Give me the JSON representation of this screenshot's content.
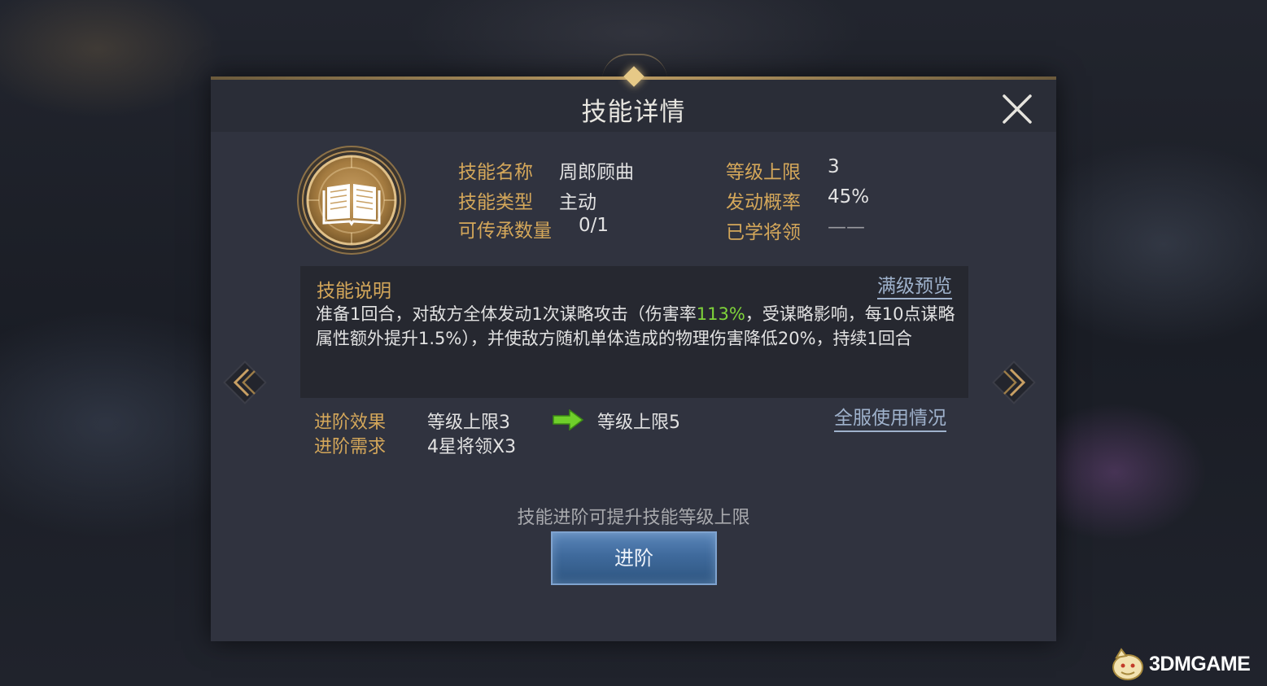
{
  "dialog": {
    "title": "技能详情"
  },
  "skill": {
    "name_label": "技能名称",
    "name_value": "周郎顾曲",
    "type_label": "技能类型",
    "type_value": "主动",
    "inherit_label": "可传承数量",
    "inherit_value": "0/1",
    "level_cap_label": "等级上限",
    "level_cap_value": "3",
    "trigger_rate_label": "发动概率",
    "trigger_rate_value": "45%",
    "learned_label": "已学将领",
    "learned_value": "——",
    "icon": "open-book-icon"
  },
  "description": {
    "title": "技能说明",
    "preview_link": "满级预览",
    "text_part1": "准备1回合，对敌方全体发动1次谋略攻击（伤害率",
    "text_highlight": "113%",
    "text_part2": "，受谋略影响，每10点谋略属性额外提升1.5%），并使敌方随机单体造成的物理伤害降低20%，持续1回合"
  },
  "advance": {
    "effect_label": "进阶效果",
    "effect_from": "等级上限3",
    "effect_to": "等级上限5",
    "requirement_label": "进阶需求",
    "requirement_value": "4星将领X3",
    "usage_link": "全服使用情况",
    "hint": "技能进阶可提升技能等级上限",
    "button_label": "进阶"
  },
  "watermark": {
    "text": "3DMGAME"
  },
  "colors": {
    "gold_label": "#d4a75a",
    "highlight_green": "#7fd43a",
    "link_blue": "#9fb2cc",
    "button_blue": "#3f6a9c"
  }
}
